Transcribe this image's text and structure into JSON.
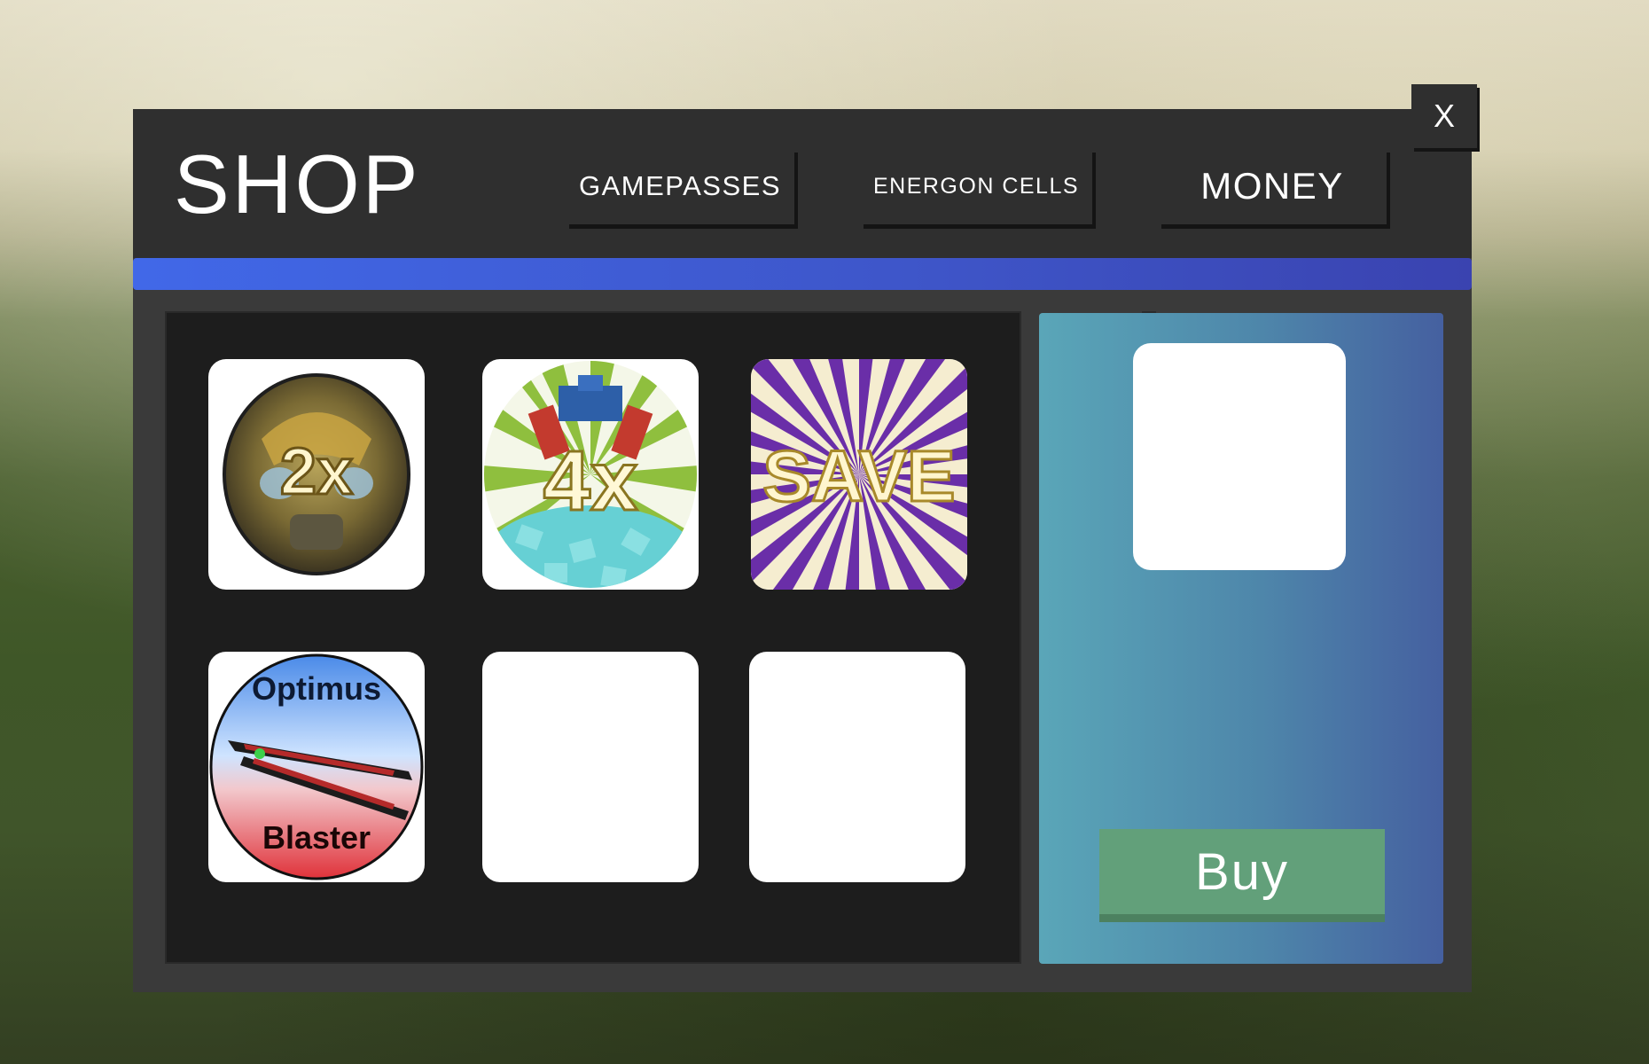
{
  "shop": {
    "title": "SHOP",
    "close_label": "X",
    "tabs": [
      {
        "label": "GAMEPASSES"
      },
      {
        "label": "ENERGON CELLS"
      },
      {
        "label": "MONEY"
      }
    ]
  },
  "items": [
    {
      "icon": "bumblebee-2x-icon",
      "text": "2x"
    },
    {
      "icon": "optimus-4x-icon",
      "text": "4x"
    },
    {
      "icon": "save-burst-icon",
      "text": "SAVE"
    },
    {
      "icon": "optimus-blaster-icon",
      "text_top": "Optimus",
      "text_bottom": "Blaster"
    },
    {
      "icon": "empty-slot"
    },
    {
      "icon": "empty-slot"
    }
  ],
  "detail": {
    "buy_label": "Buy"
  },
  "colors": {
    "accent_blue": "#4168e8",
    "buy_green": "#62a07a",
    "panel_teal": "#5aa6b8"
  }
}
